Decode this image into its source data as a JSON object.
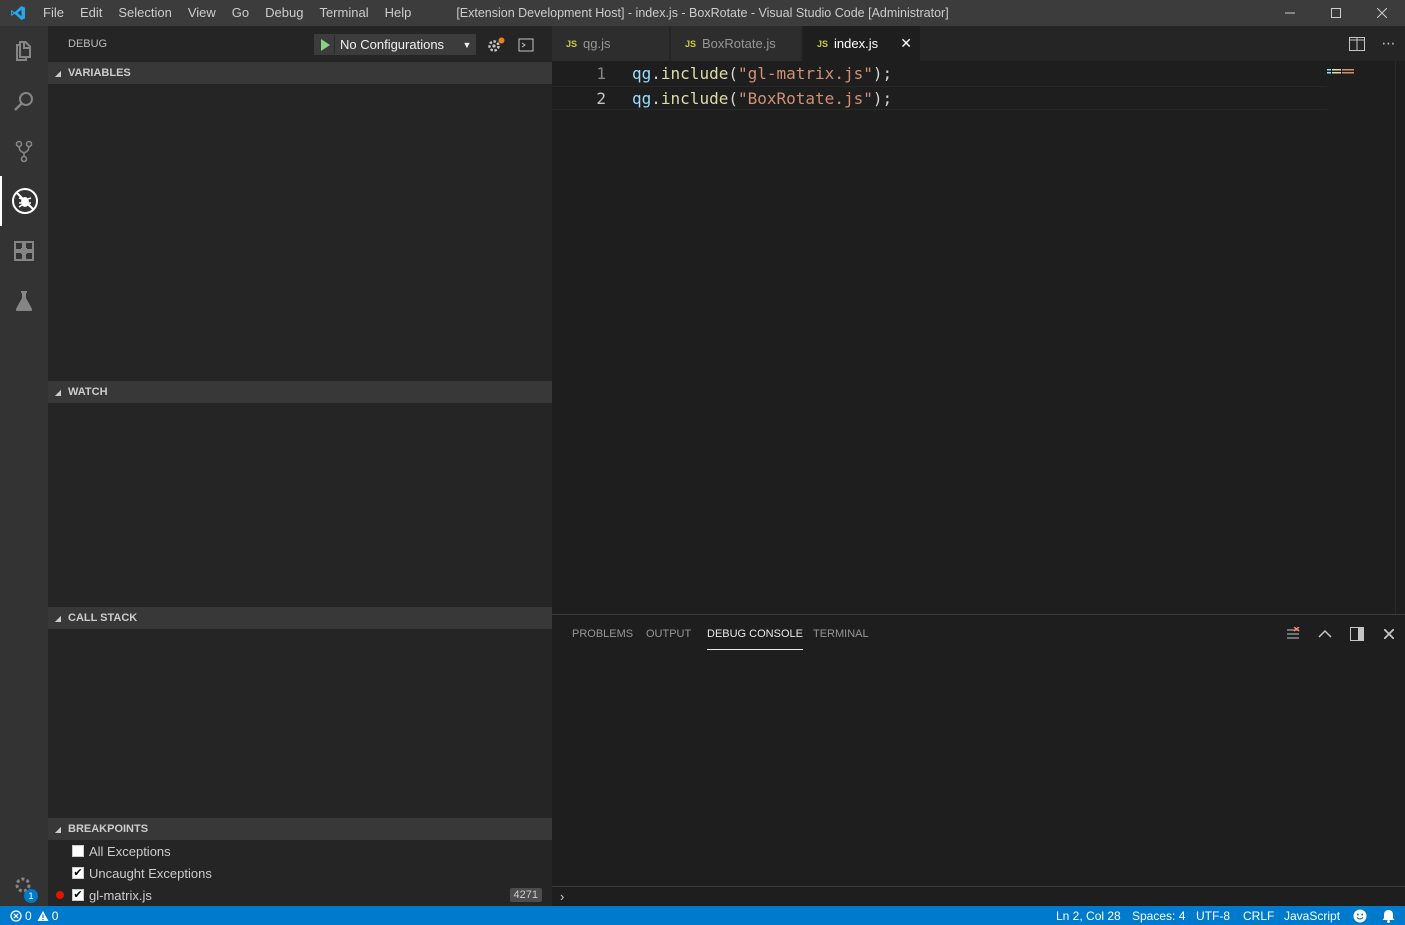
{
  "titlebar": {
    "menu": [
      "File",
      "Edit",
      "Selection",
      "View",
      "Go",
      "Debug",
      "Terminal",
      "Help"
    ],
    "window_title": "[Extension Development Host] - index.js - BoxRotate - Visual Studio Code [Administrator]"
  },
  "activity_bar": {
    "items": [
      "explorer-icon",
      "search-icon",
      "source-control-icon",
      "debug-icon",
      "extensions-icon",
      "test-flask-icon"
    ],
    "active": "debug-icon",
    "settings_badge": "1"
  },
  "sidebar": {
    "title": "DEBUG",
    "config_select": "No Configurations",
    "sections": {
      "variables": "VARIABLES",
      "watch": "WATCH",
      "call_stack": "CALL STACK",
      "breakpoints": "BREAKPOINTS"
    },
    "breakpoints": [
      {
        "label": "All Exceptions",
        "checked": false
      },
      {
        "label": "Uncaught Exceptions",
        "checked": true
      },
      {
        "label": "gl-matrix.js",
        "checked": true,
        "line": "4271"
      }
    ]
  },
  "tabs": [
    {
      "label": "qg.js",
      "active": false
    },
    {
      "label": "BoxRotate.js",
      "active": false
    },
    {
      "label": "index.js",
      "active": true
    }
  ],
  "tab_prefix": "JS",
  "editor": {
    "lines": [
      {
        "num": "1",
        "var": "qg",
        "dot": ".",
        "fn": "include",
        "open": "(",
        "str": "\"gl-matrix.js\"",
        "close": ");"
      },
      {
        "num": "2",
        "var": "qg",
        "dot": ".",
        "fn": "include",
        "open": "(",
        "str": "\"BoxRotate.js\"",
        "close": ");"
      }
    ]
  },
  "panel": {
    "tabs": [
      "PROBLEMS",
      "OUTPUT",
      "DEBUG CONSOLE",
      "TERMINAL"
    ],
    "active_tab": "DEBUG CONSOLE",
    "prompt": "›"
  },
  "statusbar": {
    "errors": "0",
    "warnings": "0",
    "position": "Ln 2, Col 28",
    "spaces": "Spaces: 4",
    "encoding": "UTF-8",
    "eol": "CRLF",
    "language": "JavaScript"
  },
  "colors": {
    "accent": "#007acc",
    "breakpoint": "#e51400",
    "js_icon": "#cbcb41"
  }
}
